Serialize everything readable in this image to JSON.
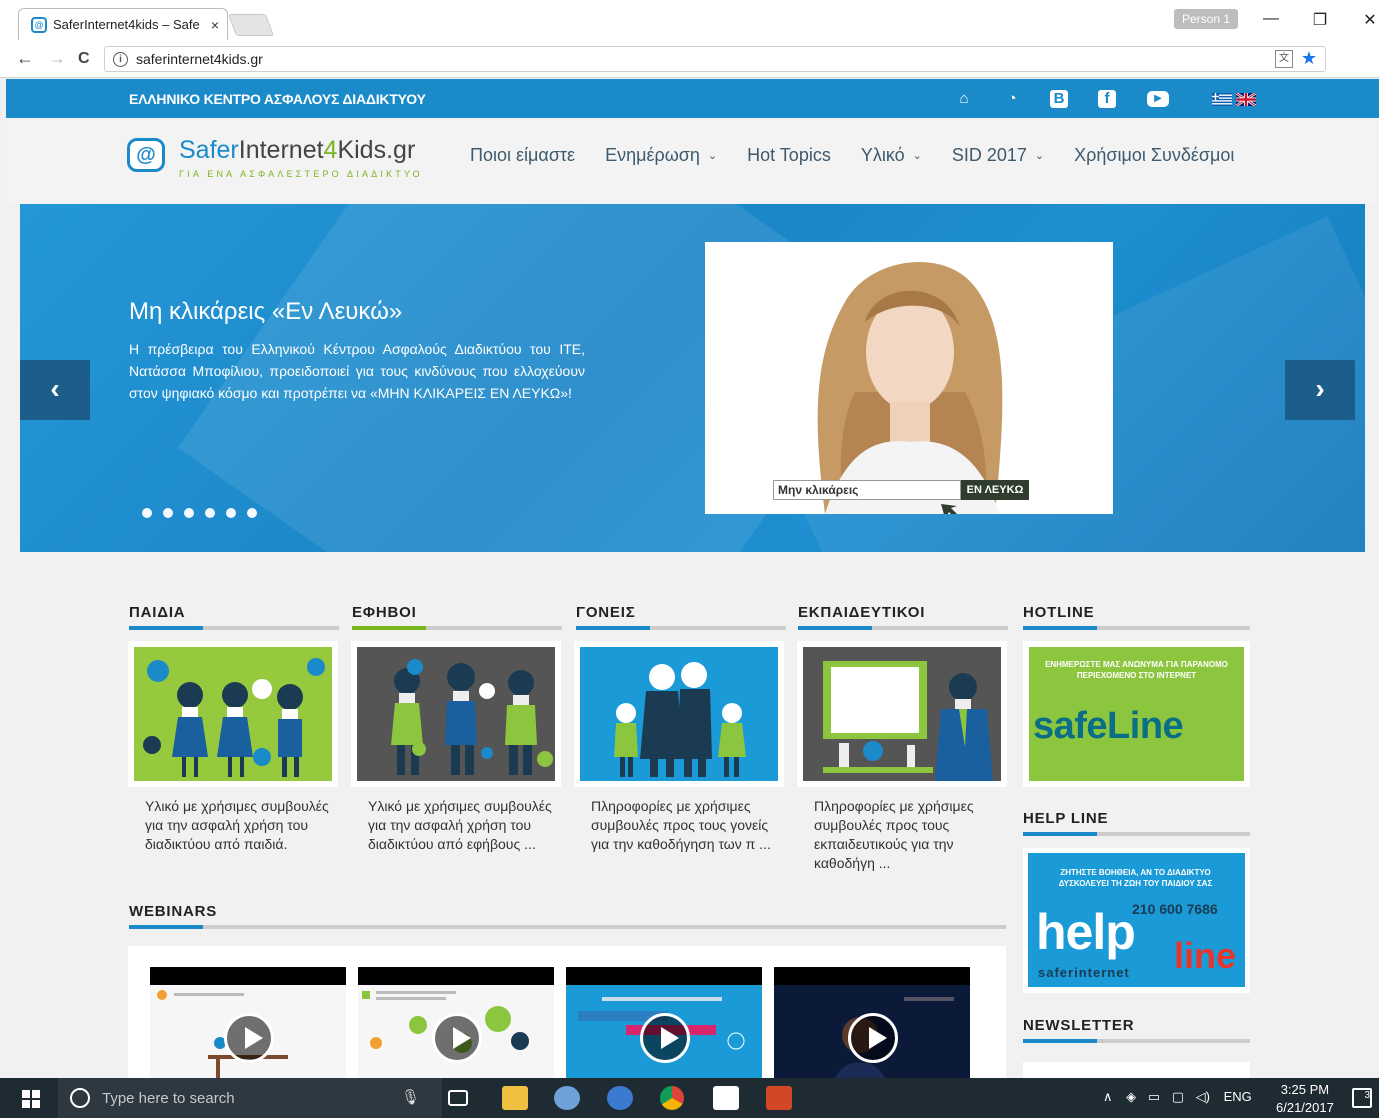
{
  "browser": {
    "tab_title": "SaferInternet4kids – Safe",
    "tab_close": "×",
    "person": "Person 1",
    "minimize": "—",
    "restore": "❐",
    "close": "✕",
    "back": "←",
    "forward": "→",
    "reload": "C",
    "url": "saferinternet4kids.gr"
  },
  "topbar": {
    "title": "ΕΛΛΗΝΙΚΟ ΚΕΝΤΡΟ ΑΣΦΑΛΟΥΣ ΔΙΑΔΙΚΤΥΟΥ",
    "icons": [
      "home-icon",
      "rss-icon",
      "blogger-icon",
      "facebook-icon",
      "youtube-icon",
      "greek-flag-icon",
      "uk-flag-icon"
    ]
  },
  "header": {
    "logo_brand_1": "Safer",
    "logo_brand_2": "Internet",
    "logo_brand_3": "4",
    "logo_brand_4": "Kids",
    "logo_brand_5": ".gr",
    "logo_tag": "ΓΙΑ ΕΝΑ ΑΣΦΑΛΕΣΤΕΡΟ ΔΙΑΔΙΚΤΥΟ",
    "menu": [
      {
        "label": "Ποιοι είμαστε",
        "dropdown": false
      },
      {
        "label": "Ενημέρωση",
        "dropdown": true
      },
      {
        "label": "Hot Topics",
        "dropdown": false
      },
      {
        "label": "Υλικό",
        "dropdown": true
      },
      {
        "label": "SID 2017",
        "dropdown": true
      },
      {
        "label": "Χρήσιμοι Συνδέσμοι",
        "dropdown": false
      }
    ]
  },
  "slider": {
    "title": "Μη κλικάρεις «Εν Λευκώ»",
    "text": "Η πρέσβειρα του Ελληνικού Κέντρου Ασφαλούς Διαδικτύου του ΙΤΕ, Νατάσσα Μποφίλιου, προειδοποιεί για τους κινδύνους που ελλοχεύουν στον ψηφιακό κόσμο και προτρέπει να «ΜΗΝ ΚΛΙΚΑΡΕΙΣ ΕΝ ΛΕΥΚΩ»!",
    "prev": "‹",
    "next": "›",
    "dots": 6,
    "image_search_text": "Μην κλικάρεις",
    "image_button": "ΕΝ ΛΕΥΚΩ"
  },
  "sections": [
    {
      "title": "ΠΑΙΔΙΑ",
      "text": "Υλικό με χρήσιμες συμβουλές για την ασφαλή χρήση του διαδικτύου από παιδιά.",
      "accent": "#1a8ac9"
    },
    {
      "title": "ΕΦΗΒΟΙ",
      "text": "Υλικό με χρήσιμες συμβουλές για την ασφαλή χρήση του διαδικτύου από εφήβους ...",
      "accent": "#7ab51d"
    },
    {
      "title": "ΓΟΝΕΙΣ",
      "text": "Πληροφορίες με χρήσιμες συμβουλές προς τους γονείς για την καθοδήγηση των π ...",
      "accent": "#1a8ac9"
    },
    {
      "title": "ΕΚΠΑΙΔΕΥΤΙΚΟΙ",
      "text": "Πληροφορίες με χρήσιμες συμβουλές προς τους εκπαιδευτικούς για την καθοδήγη ...",
      "accent": "#1a8ac9"
    }
  ],
  "webinars": {
    "title": "WEBINARS"
  },
  "side": {
    "hotline": "HOTLINE",
    "hotline_banner_top": "ΕΝΗΜΕΡΩΣΤΕ ΜΑΣ ΑΝΩΝΥΜΑ ΓΙΑ ΠΑΡΑΝΟΜΟ ΠΕΡΙΕΧΟΜΕΝΟ ΣΤΟ ΙΝΤΕΡΝΕΤ",
    "hotline_banner_logo": "safeLine",
    "helpline": "HELP LINE",
    "helpline_banner_top": "ΖΗΤΗΣΤΕ ΒΟΗΘΕΙΑ, ΑΝ ΤΟ ΔΙΑΔΙΚΤΥΟ ΔΥΣΚΟΛΕΥΕΙ ΤΗ ΖΩΗ ΤΟΥ ΠΑΙΔΙΟΥ ΣΑΣ",
    "helpline_phone": "210 600 7686",
    "helpline_logo_1": "help",
    "helpline_logo_2": "line",
    "helpline_sub": "saferinternet",
    "newsletter": "NEWSLETTER"
  },
  "taskbar": {
    "search_placeholder": "Type here to search",
    "lang": "ENG",
    "time": "3:25 PM",
    "date": "6/21/2017",
    "notifications": "3"
  },
  "colors": {
    "brand_blue": "#1a8ac9",
    "brand_green": "#7ab51d"
  }
}
